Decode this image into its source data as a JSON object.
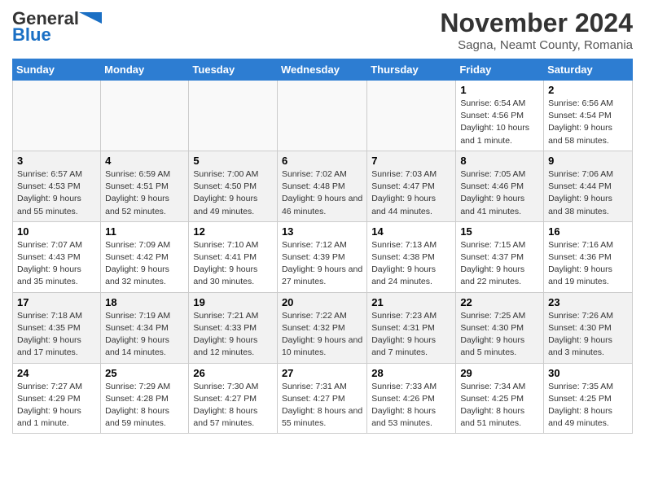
{
  "header": {
    "logo_general": "General",
    "logo_blue": "Blue",
    "month": "November 2024",
    "location": "Sagna, Neamt County, Romania"
  },
  "days_of_week": [
    "Sunday",
    "Monday",
    "Tuesday",
    "Wednesday",
    "Thursday",
    "Friday",
    "Saturday"
  ],
  "weeks": [
    [
      {
        "day": "",
        "info": ""
      },
      {
        "day": "",
        "info": ""
      },
      {
        "day": "",
        "info": ""
      },
      {
        "day": "",
        "info": ""
      },
      {
        "day": "",
        "info": ""
      },
      {
        "day": "1",
        "info": "Sunrise: 6:54 AM\nSunset: 4:56 PM\nDaylight: 10 hours and 1 minute."
      },
      {
        "day": "2",
        "info": "Sunrise: 6:56 AM\nSunset: 4:54 PM\nDaylight: 9 hours and 58 minutes."
      }
    ],
    [
      {
        "day": "3",
        "info": "Sunrise: 6:57 AM\nSunset: 4:53 PM\nDaylight: 9 hours and 55 minutes."
      },
      {
        "day": "4",
        "info": "Sunrise: 6:59 AM\nSunset: 4:51 PM\nDaylight: 9 hours and 52 minutes."
      },
      {
        "day": "5",
        "info": "Sunrise: 7:00 AM\nSunset: 4:50 PM\nDaylight: 9 hours and 49 minutes."
      },
      {
        "day": "6",
        "info": "Sunrise: 7:02 AM\nSunset: 4:48 PM\nDaylight: 9 hours and 46 minutes."
      },
      {
        "day": "7",
        "info": "Sunrise: 7:03 AM\nSunset: 4:47 PM\nDaylight: 9 hours and 44 minutes."
      },
      {
        "day": "8",
        "info": "Sunrise: 7:05 AM\nSunset: 4:46 PM\nDaylight: 9 hours and 41 minutes."
      },
      {
        "day": "9",
        "info": "Sunrise: 7:06 AM\nSunset: 4:44 PM\nDaylight: 9 hours and 38 minutes."
      }
    ],
    [
      {
        "day": "10",
        "info": "Sunrise: 7:07 AM\nSunset: 4:43 PM\nDaylight: 9 hours and 35 minutes."
      },
      {
        "day": "11",
        "info": "Sunrise: 7:09 AM\nSunset: 4:42 PM\nDaylight: 9 hours and 32 minutes."
      },
      {
        "day": "12",
        "info": "Sunrise: 7:10 AM\nSunset: 4:41 PM\nDaylight: 9 hours and 30 minutes."
      },
      {
        "day": "13",
        "info": "Sunrise: 7:12 AM\nSunset: 4:39 PM\nDaylight: 9 hours and 27 minutes."
      },
      {
        "day": "14",
        "info": "Sunrise: 7:13 AM\nSunset: 4:38 PM\nDaylight: 9 hours and 24 minutes."
      },
      {
        "day": "15",
        "info": "Sunrise: 7:15 AM\nSunset: 4:37 PM\nDaylight: 9 hours and 22 minutes."
      },
      {
        "day": "16",
        "info": "Sunrise: 7:16 AM\nSunset: 4:36 PM\nDaylight: 9 hours and 19 minutes."
      }
    ],
    [
      {
        "day": "17",
        "info": "Sunrise: 7:18 AM\nSunset: 4:35 PM\nDaylight: 9 hours and 17 minutes."
      },
      {
        "day": "18",
        "info": "Sunrise: 7:19 AM\nSunset: 4:34 PM\nDaylight: 9 hours and 14 minutes."
      },
      {
        "day": "19",
        "info": "Sunrise: 7:21 AM\nSunset: 4:33 PM\nDaylight: 9 hours and 12 minutes."
      },
      {
        "day": "20",
        "info": "Sunrise: 7:22 AM\nSunset: 4:32 PM\nDaylight: 9 hours and 10 minutes."
      },
      {
        "day": "21",
        "info": "Sunrise: 7:23 AM\nSunset: 4:31 PM\nDaylight: 9 hours and 7 minutes."
      },
      {
        "day": "22",
        "info": "Sunrise: 7:25 AM\nSunset: 4:30 PM\nDaylight: 9 hours and 5 minutes."
      },
      {
        "day": "23",
        "info": "Sunrise: 7:26 AM\nSunset: 4:30 PM\nDaylight: 9 hours and 3 minutes."
      }
    ],
    [
      {
        "day": "24",
        "info": "Sunrise: 7:27 AM\nSunset: 4:29 PM\nDaylight: 9 hours and 1 minute."
      },
      {
        "day": "25",
        "info": "Sunrise: 7:29 AM\nSunset: 4:28 PM\nDaylight: 8 hours and 59 minutes."
      },
      {
        "day": "26",
        "info": "Sunrise: 7:30 AM\nSunset: 4:27 PM\nDaylight: 8 hours and 57 minutes."
      },
      {
        "day": "27",
        "info": "Sunrise: 7:31 AM\nSunset: 4:27 PM\nDaylight: 8 hours and 55 minutes."
      },
      {
        "day": "28",
        "info": "Sunrise: 7:33 AM\nSunset: 4:26 PM\nDaylight: 8 hours and 53 minutes."
      },
      {
        "day": "29",
        "info": "Sunrise: 7:34 AM\nSunset: 4:25 PM\nDaylight: 8 hours and 51 minutes."
      },
      {
        "day": "30",
        "info": "Sunrise: 7:35 AM\nSunset: 4:25 PM\nDaylight: 8 hours and 49 minutes."
      }
    ]
  ]
}
